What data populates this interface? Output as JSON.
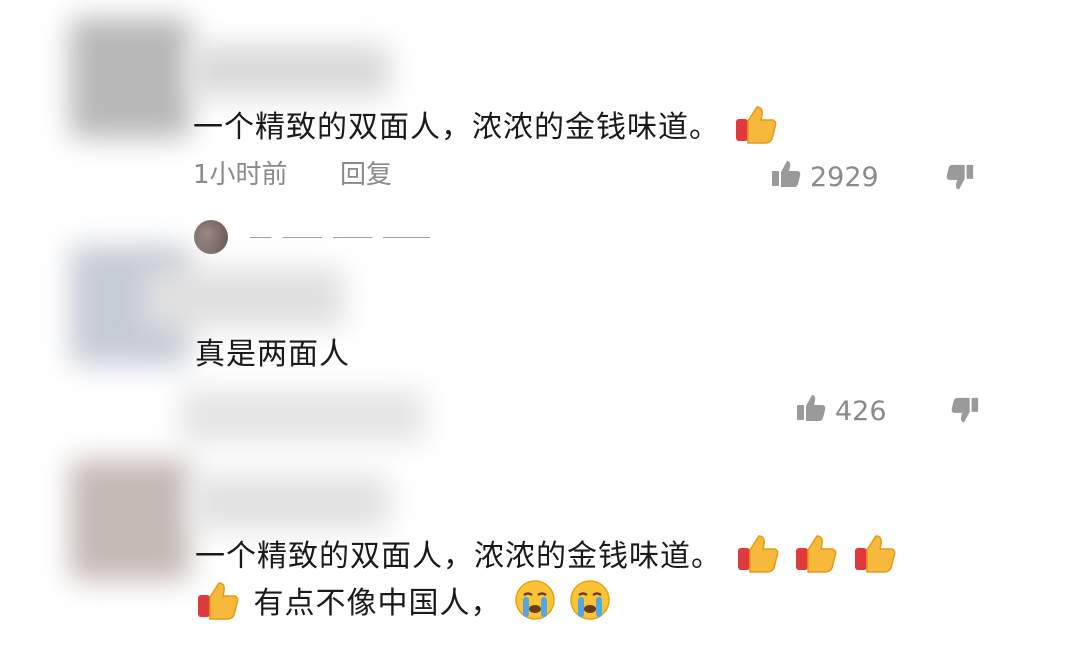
{
  "comments": [
    {
      "text": "一个精致的双面人，浓浓的金钱味道。",
      "time": "1小时前",
      "reply_label": "回复",
      "likes": "2929"
    },
    {
      "text": "真是两面人",
      "likes": "426"
    },
    {
      "line1": "一个精致的双面人，浓浓的金钱味道。",
      "line2": "有点不像中国人，"
    }
  ],
  "icons": {
    "like": "thumbs-up-outline",
    "dislike": "thumbs-down-outline",
    "emoji_thumbs": "thumbs-up-emoji",
    "emoji_cry": "crying-face-emoji"
  },
  "colors": {
    "meta_text": "#8a8a8a",
    "text": "#1a1a1a"
  }
}
